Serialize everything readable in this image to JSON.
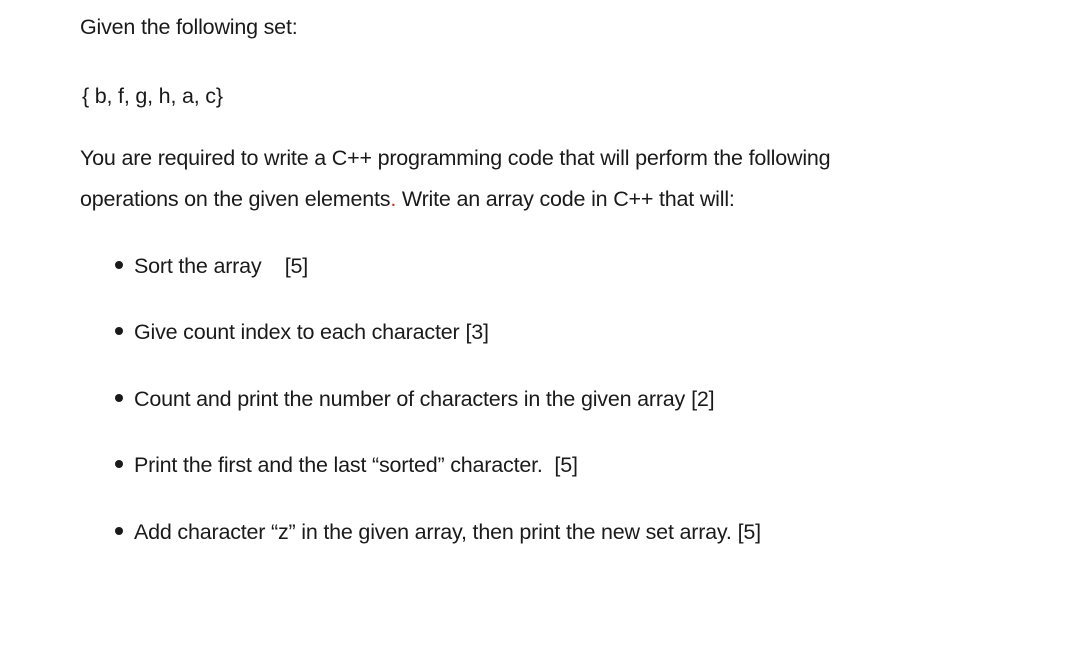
{
  "document": {
    "intro": "Given the following set:",
    "set": "{ b, f, g, h, a, c}",
    "requirement_line1": "You are required to write a C++ programming code that will perform the following",
    "requirement_line2_a": "operations on the given elements",
    "requirement_line2_dot": ".",
    "requirement_line2_b": " Write an array code in C++ that will:",
    "tasks": [
      {
        "text": "Sort the array",
        "marks": "   [5]"
      },
      {
        "text": "Give count index to each character",
        "marks": "[3]"
      },
      {
        "text": "Count and print the number of characters in the given array",
        "marks": "[2]"
      },
      {
        "text": "Print the first and the last “sorted” character.",
        "marks": " [5]"
      },
      {
        "text": "Add character “z” in the given array, then print the new set array.",
        "marks": "[5]"
      }
    ]
  }
}
